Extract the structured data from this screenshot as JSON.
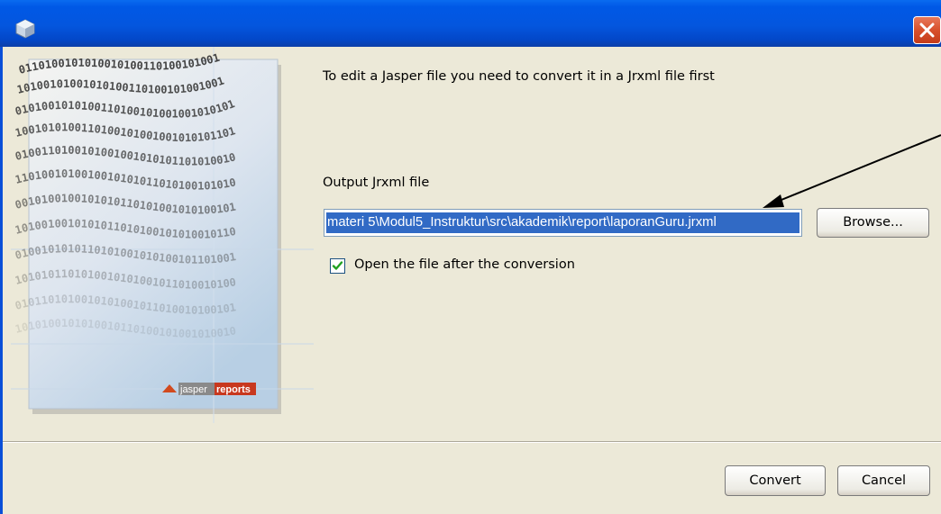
{
  "window": {
    "title": "",
    "icon": "jasper-app-icon",
    "close_icon": "close-icon"
  },
  "banner": {
    "logo_part1": "jasper",
    "logo_part2": "reports",
    "binary_lines": [
      "0110100101010010100110100101001001",
      "1010010100101010011010010100100101",
      "0101001010100110100101001001010101",
      "1001010100110100101001001010101101",
      "0100110100101001001010101101010010",
      "1101001010010010101011010100101010",
      "0010100100101010110101001010100101",
      "1010010010101011010100101010010110",
      "0100101010110101001010100101101001",
      "1010101101010010101001011010010100",
      "0101101010010101001011010010100101",
      "1010100101010010110100101001010010"
    ]
  },
  "message": "To edit a Jasper file you need to convert it in a Jrxml file first",
  "output": {
    "label": "Output Jrxml file",
    "path_value": "materi 5\\Modul5_Instruktur\\src\\akademik\\report\\laporanGuru.jrxml",
    "browse_label": "Browse..."
  },
  "open_after": {
    "checked": true,
    "label": "Open the file after the conversion"
  },
  "buttons": {
    "convert": "Convert",
    "cancel": "Cancel"
  },
  "colors": {
    "titlebar": "#0456de",
    "dialog_bg": "#ece9d8",
    "selection": "#316ac5",
    "close_red": "#d8502c",
    "checkmark": "#21a121"
  }
}
